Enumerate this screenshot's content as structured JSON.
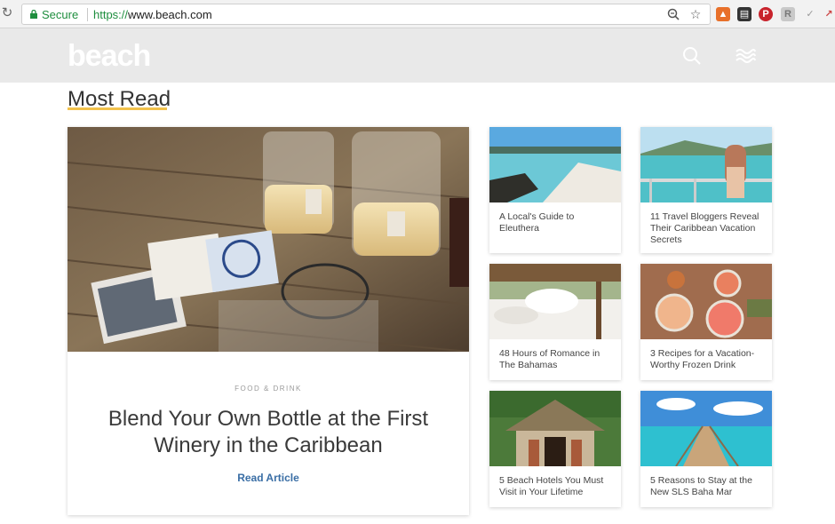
{
  "browser": {
    "secure_label": "Secure",
    "url_proto": "https://",
    "url_host": "www.beach.com",
    "icons": [
      "reload-icon",
      "lock-icon",
      "zoom-icon",
      "star-icon",
      "extension-icons"
    ]
  },
  "header": {
    "logo": "beach",
    "icons": [
      "search-icon",
      "menu-wave-icon"
    ]
  },
  "section": {
    "title": "Most Read",
    "accent_color": "#f2c24b"
  },
  "feature": {
    "category": "FOOD & DRINK",
    "title": "Blend Your Own Bottle at the First Winery in the Caribbean",
    "link": "Read Article",
    "link_color": "#3a6ea5"
  },
  "cards": [
    {
      "title": "A Local's Guide to Eleuthera"
    },
    {
      "title": "11 Travel Bloggers Reveal Their Caribbean Vacation Secrets"
    },
    {
      "title": "48 Hours of Romance in The Bahamas"
    },
    {
      "title": "3 Recipes for a Vacation-Worthy Frozen Drink"
    },
    {
      "title": "5 Beach Hotels You Must Visit in Your Lifetime"
    },
    {
      "title": "5 Reasons to Stay at the New SLS Baha Mar"
    }
  ]
}
